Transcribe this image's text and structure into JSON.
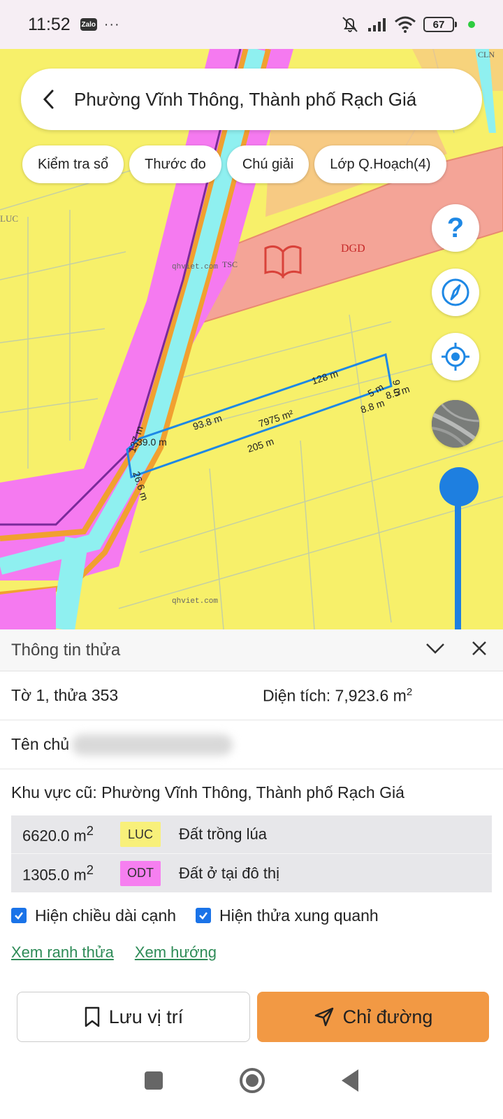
{
  "status": {
    "time": "11:52",
    "zalo": "Zalo",
    "more": "···",
    "battery": "67"
  },
  "search": {
    "title": "Phường Vĩnh Thông, Thành phố Rạch Giá"
  },
  "chips": [
    {
      "label": "Kiểm tra sổ"
    },
    {
      "label": "Thước đo"
    },
    {
      "label": "Chú giải"
    },
    {
      "label": "Lớp Q.Hoạch(4)"
    }
  ],
  "fabs": {
    "help": "?"
  },
  "map": {
    "labels": {
      "dgd": "DGD",
      "luc": "LUC",
      "tsc": "TSC",
      "cln": "CLN",
      "watermark": "qhviet.com"
    },
    "edges": {
      "e128": "128 m",
      "e93": "93.8 m",
      "e205": "205 m",
      "e137": "137 m",
      "e39": "39.0 m",
      "e266": "26.6 m",
      "e88": "8.8 m",
      "e85": "8.5 m",
      "e5": "5 m",
      "e9": "9 m",
      "area": "7975 m²"
    },
    "colors": {
      "residential": "#f7f06a",
      "canal": "#8ff0f0",
      "pink": "#f57af0",
      "salmon": "#f0a08a",
      "parcel_outline": "#1e88e5"
    }
  },
  "panel": {
    "title": "Thông tin thửa",
    "parcel": "Tờ 1, thửa 353",
    "area_label": "Diện tích: 7,923.6 m",
    "area_sup": "2",
    "owner_label": "Tên chủ",
    "old_area": "Khu vực cũ: Phường Vĩnh Thông, Thành phố Rạch Giá",
    "land_use": [
      {
        "area": "6620.0 m",
        "sup": "2",
        "code": "LUC",
        "desc": "Đất trồng lúa",
        "color": "#f8f07a"
      },
      {
        "area": "1305.0 m",
        "sup": "2",
        "code": "ODT",
        "desc": "Đất ở tại đô thị",
        "color": "#f67ff0"
      }
    ],
    "checks": {
      "edge_length": "Hiện chiều dài cạnh",
      "neighbors": "Hiện thửa xung quanh"
    },
    "links": {
      "boundary": "Xem ranh thửa",
      "direction": "Xem hướng"
    },
    "buttons": {
      "save": "Lưu vị trí",
      "route": "Chỉ đường"
    }
  }
}
